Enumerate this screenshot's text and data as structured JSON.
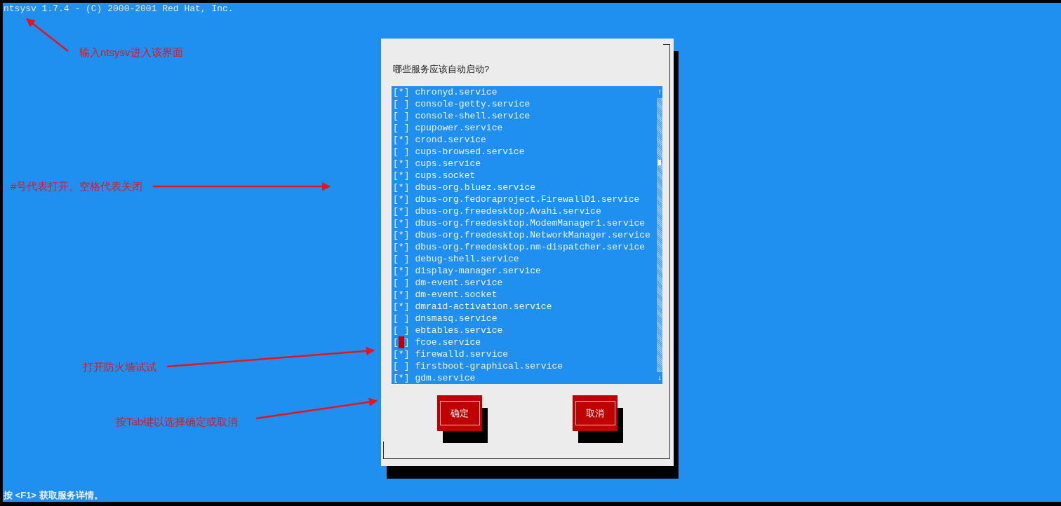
{
  "header": "ntsysv 1.7.4 - (C) 2000-2001 Red Hat, Inc.",
  "dialog": {
    "prompt": "哪些服务应该自动启动?",
    "box_on": "[*]",
    "box_off": "[ ]",
    "items": [
      {
        "label": "chronyd.service",
        "checked": true,
        "focused": false
      },
      {
        "label": "console-getty.service",
        "checked": false,
        "focused": false
      },
      {
        "label": "console-shell.service",
        "checked": false,
        "focused": false
      },
      {
        "label": "cpupower.service",
        "checked": false,
        "focused": false
      },
      {
        "label": "crond.service",
        "checked": true,
        "focused": false
      },
      {
        "label": "cups-browsed.service",
        "checked": false,
        "focused": false
      },
      {
        "label": "cups.service",
        "checked": true,
        "focused": false
      },
      {
        "label": "cups.socket",
        "checked": true,
        "focused": false
      },
      {
        "label": "dbus-org.bluez.service",
        "checked": true,
        "focused": false
      },
      {
        "label": "dbus-org.fedoraproject.FirewallD1.service",
        "checked": true,
        "focused": false
      },
      {
        "label": "dbus-org.freedesktop.Avahi.service",
        "checked": true,
        "focused": false
      },
      {
        "label": "dbus-org.freedesktop.ModemManager1.service",
        "checked": true,
        "focused": false
      },
      {
        "label": "dbus-org.freedesktop.NetworkManager.service",
        "checked": true,
        "focused": false
      },
      {
        "label": "dbus-org.freedesktop.nm-dispatcher.service",
        "checked": true,
        "focused": false
      },
      {
        "label": "debug-shell.service",
        "checked": false,
        "focused": false
      },
      {
        "label": "display-manager.service",
        "checked": true,
        "focused": false
      },
      {
        "label": "dm-event.service",
        "checked": false,
        "focused": false
      },
      {
        "label": "dm-event.socket",
        "checked": true,
        "focused": false
      },
      {
        "label": "dmraid-activation.service",
        "checked": true,
        "focused": false
      },
      {
        "label": "dnsmasq.service",
        "checked": false,
        "focused": false
      },
      {
        "label": "ebtables.service",
        "checked": false,
        "focused": false
      },
      {
        "label": "fcoe.service",
        "checked": false,
        "focused": true
      },
      {
        "label": "firewalld.service",
        "checked": true,
        "focused": false
      },
      {
        "label": "firstboot-graphical.service",
        "checked": false,
        "focused": false
      },
      {
        "label": "gdm.service",
        "checked": true,
        "focused": false
      }
    ],
    "scroll_up": "↑",
    "scroll_down": "↓",
    "buttons": [
      "确定",
      "取消"
    ]
  },
  "status_line": "按 <F1> 获取服务详情。",
  "annotations": [
    "输入ntsysv进入该界面",
    "#号代表打开。空格代表关闭",
    "打开防火墙试试",
    "按Tab键以选择确定或取消"
  ]
}
